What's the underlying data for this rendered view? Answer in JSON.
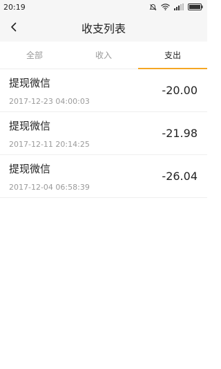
{
  "status": {
    "time": "20:19"
  },
  "nav": {
    "title": "收支列表"
  },
  "tabs": [
    {
      "label": "全部",
      "active": false
    },
    {
      "label": "收入",
      "active": false
    },
    {
      "label": "支出",
      "active": true
    }
  ],
  "accent_color": "#f5a623",
  "records": [
    {
      "title": "提现微信",
      "time": "2017-12-23 04:00:03",
      "amount": "-20.00"
    },
    {
      "title": "提现微信",
      "time": "2017-12-11 20:14:25",
      "amount": "-21.98"
    },
    {
      "title": "提现微信",
      "time": "2017-12-04 06:58:39",
      "amount": "-26.04"
    }
  ]
}
